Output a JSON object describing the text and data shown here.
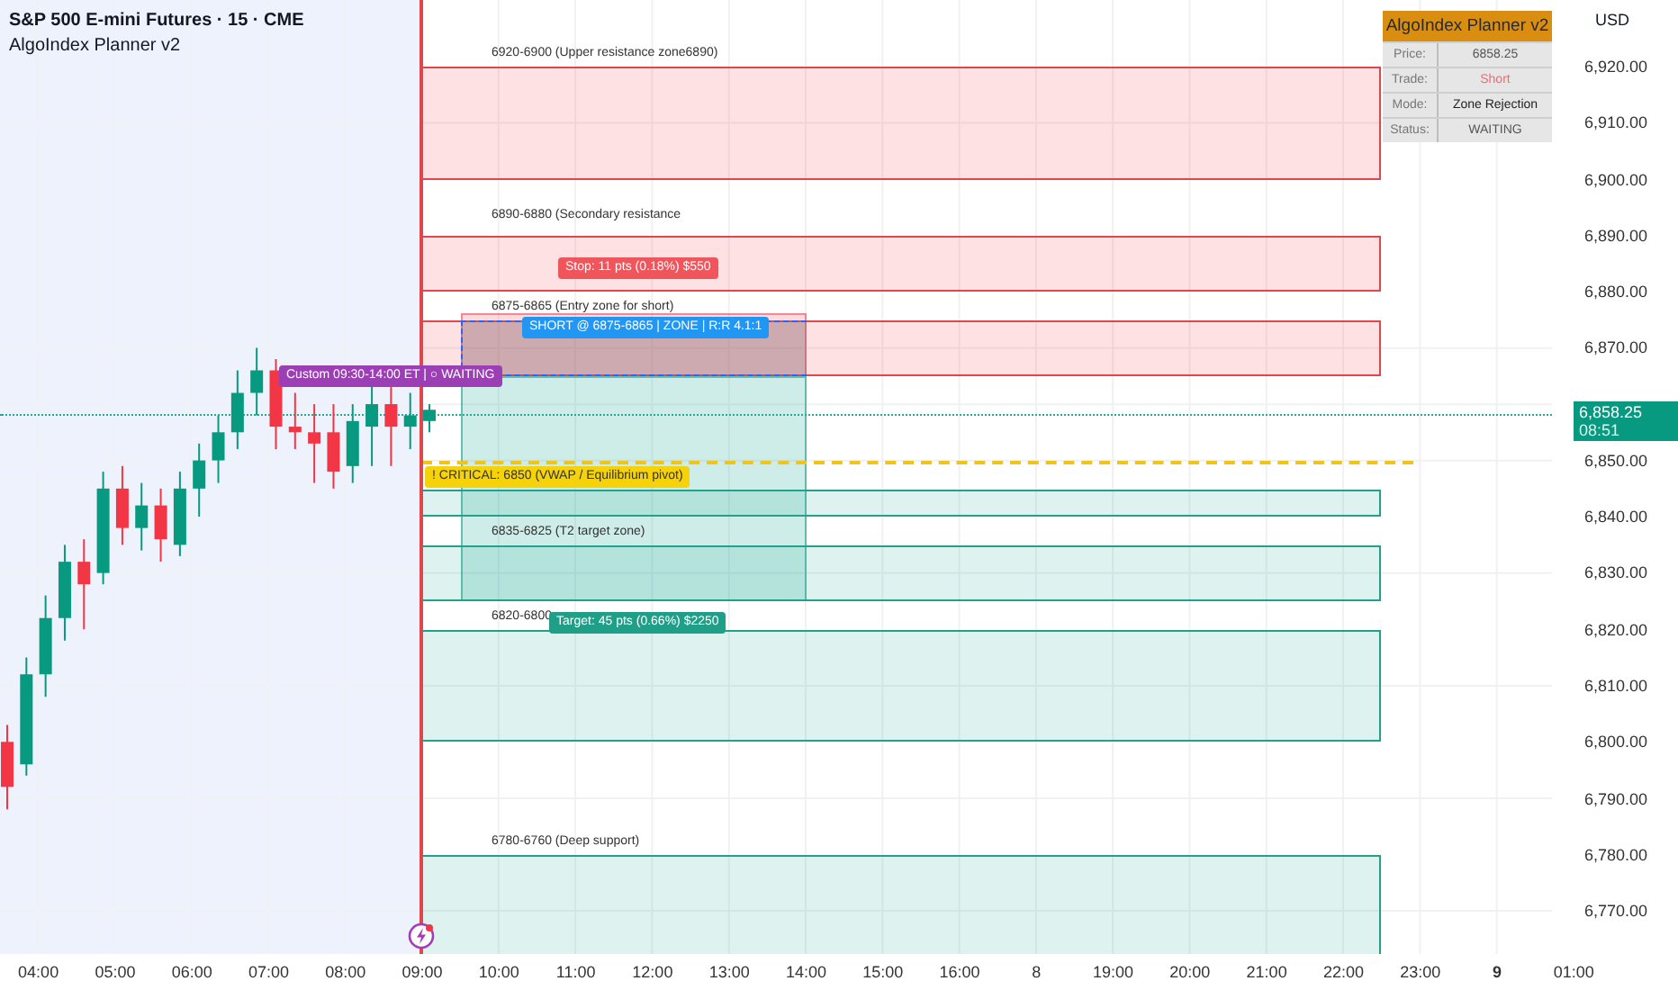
{
  "header": {
    "symbol": "S&P 500 E-mini Futures · 15 · CME",
    "indicator": "AlgoIndex Planner v2"
  },
  "info_panel": {
    "title": "AlgoIndex Planner v2",
    "rows": [
      {
        "label": "Price:",
        "value": "6858.25",
        "kind": "plain"
      },
      {
        "label": "Trade:",
        "value": "Short",
        "kind": "short"
      },
      {
        "label": "Mode:",
        "value": "Zone Rejection",
        "kind": "strong"
      },
      {
        "label": "Status:",
        "value": "WAITING",
        "kind": "plain"
      }
    ]
  },
  "zones": [
    {
      "kind": "resistance",
      "label": "6920-6900 (Upper resistance zone6890)"
    },
    {
      "kind": "resistance",
      "label": "6890-6880 (Secondary resistance"
    },
    {
      "kind": "resistance",
      "label": "6875-6865 (Entry zone for short)"
    },
    {
      "kind": "support"
    },
    {
      "kind": "support",
      "label": "6835-6825 (T2 target zone)"
    },
    {
      "kind": "support",
      "label": "6820-6800"
    },
    {
      "kind": "support",
      "label": "6780-6760 (Deep support)"
    }
  ],
  "position": {
    "stop_label": "Stop: 11 pts (0.18%) $550",
    "entry_label": "SHORT @ 6875-6865 | ZONE | R:R 4.1:1",
    "target_label": "Target: 45 pts (0.66%) $2250"
  },
  "critical": {
    "label": "! CRITICAL: 6850 (VWAP / Equilibrium pivot)"
  },
  "session": {
    "label": "Custom 09:30-14:00 ET | ○ WAITING"
  },
  "price_axis": {
    "currency": "USD",
    "ticks": [
      "6,920.00",
      "6,910.00",
      "6,900.00",
      "6,890.00",
      "6,880.00",
      "6,870.00",
      "6,850.00",
      "6,840.00",
      "6,830.00",
      "6,820.00",
      "6,810.00",
      "6,800.00",
      "6,790.00",
      "6,780.00",
      "6,770.00"
    ],
    "current_price": "6,858.25",
    "countdown": "08:51"
  },
  "time_axis": [
    {
      "label": "04:00",
      "day": false
    },
    {
      "label": "05:00",
      "day": false
    },
    {
      "label": "06:00",
      "day": false
    },
    {
      "label": "07:00",
      "day": false
    },
    {
      "label": "08:00",
      "day": false
    },
    {
      "label": "09:00",
      "day": false
    },
    {
      "label": "10:00",
      "day": false
    },
    {
      "label": "11:00",
      "day": false
    },
    {
      "label": "12:00",
      "day": false
    },
    {
      "label": "13:00",
      "day": false
    },
    {
      "label": "14:00",
      "day": false
    },
    {
      "label": "15:00",
      "day": false
    },
    {
      "label": "16:00",
      "day": false
    },
    {
      "label": "8",
      "day": false
    },
    {
      "label": "19:00",
      "day": false
    },
    {
      "label": "20:00",
      "day": false
    },
    {
      "label": "21:00",
      "day": false
    },
    {
      "label": "22:00",
      "day": false
    },
    {
      "label": "23:00",
      "day": false
    },
    {
      "label": "9",
      "day": true
    },
    {
      "label": "01:00",
      "day": false
    }
  ]
}
